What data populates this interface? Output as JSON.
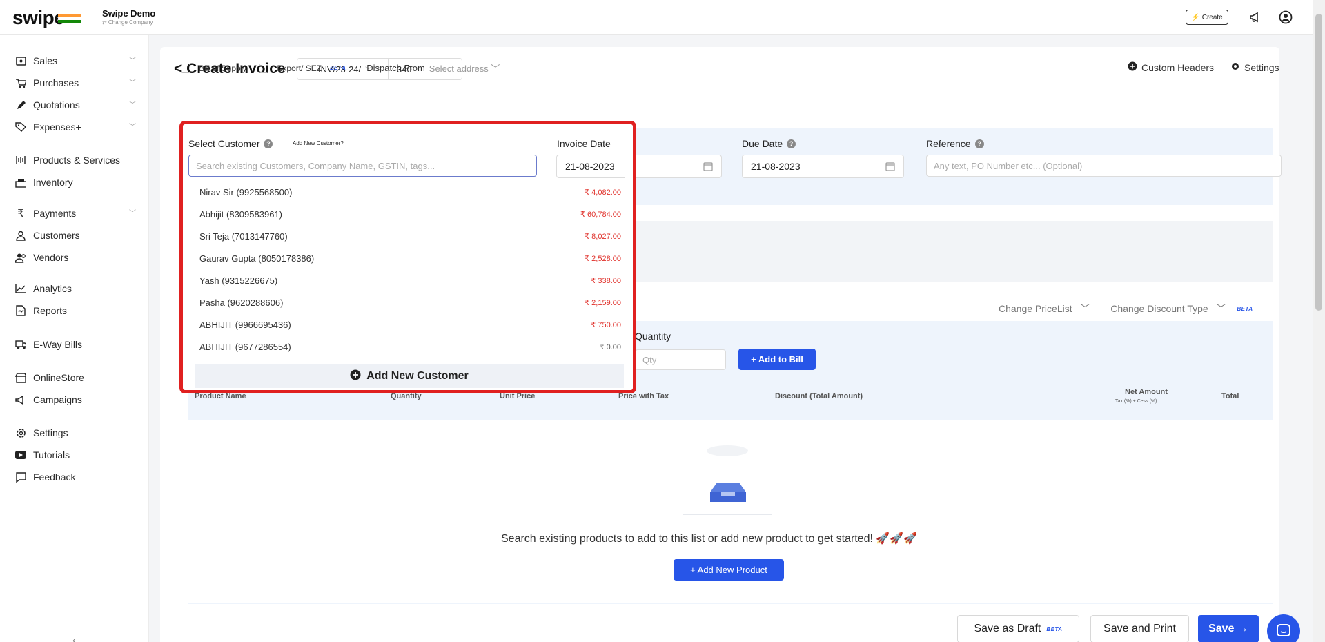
{
  "topbar": {
    "logo": "swipe",
    "company_name": "Swipe Demo",
    "change_company": "⇄ Change Company",
    "create_label": "Create"
  },
  "sidebar": {
    "items": [
      {
        "label": "Sales",
        "icon": "sales-icon",
        "has_chevron": true
      },
      {
        "label": "Purchases",
        "icon": "cart-icon",
        "has_chevron": true
      },
      {
        "label": "Quotations",
        "icon": "pen-icon",
        "has_chevron": true
      },
      {
        "label": "Expenses+",
        "icon": "tag-icon",
        "has_chevron": true
      },
      {
        "label": "Products & Services",
        "icon": "box-icon",
        "has_chevron": false
      },
      {
        "label": "Inventory",
        "icon": "inventory-icon",
        "has_chevron": false
      },
      {
        "label": "Payments",
        "icon": "rupee-icon",
        "has_chevron": true
      },
      {
        "label": "Customers",
        "icon": "user-icon",
        "has_chevron": false
      },
      {
        "label": "Vendors",
        "icon": "users-icon",
        "has_chevron": false
      },
      {
        "label": "Analytics",
        "icon": "chart-icon",
        "has_chevron": false
      },
      {
        "label": "Reports",
        "icon": "report-icon",
        "has_chevron": false
      },
      {
        "label": "E-Way Bills",
        "icon": "truck-icon",
        "has_chevron": false
      },
      {
        "label": "OnlineStore",
        "icon": "store-icon",
        "has_chevron": false
      },
      {
        "label": "Campaigns",
        "icon": "megaphone-icon",
        "has_chevron": false
      },
      {
        "label": "Settings",
        "icon": "gear-icon",
        "has_chevron": false
      },
      {
        "label": "Tutorials",
        "icon": "youtube-icon",
        "has_chevron": false
      },
      {
        "label": "Feedback",
        "icon": "chat-icon",
        "has_chevron": false
      }
    ],
    "collapse_glyph": "‹"
  },
  "header": {
    "back_label": "< Create Invoice",
    "invoice_prefix": "INV/23-24/",
    "invoice_number": "340"
  },
  "options": {
    "bill_of_supply": "Bill of Supply",
    "export_sez": "Export/ SEZ",
    "beta": "BETA",
    "dispatch_from": "Dispatch From",
    "select_address": "Select address",
    "custom_headers": "Custom Headers",
    "settings": "Settings"
  },
  "customer": {
    "label": "Select Customer",
    "add_new_link": "Add New Customer?",
    "search_placeholder": "Search existing Customers, Company Name, GSTIN, tags...",
    "list": [
      {
        "name": "Nirav Sir (9925568500)",
        "amount": "₹ 4,082.00",
        "zero": false
      },
      {
        "name": "Abhijit (8309583961)",
        "amount": "₹ 60,784.00",
        "zero": false
      },
      {
        "name": "Sri Teja (7013147760)",
        "amount": "₹ 8,027.00",
        "zero": false
      },
      {
        "name": "Gaurav Gupta (8050178386)",
        "amount": "₹ 2,528.00",
        "zero": false
      },
      {
        "name": "Yash (9315226675)",
        "amount": "₹ 338.00",
        "zero": false
      },
      {
        "name": "Pasha (9620288606)",
        "amount": "₹ 2,159.00",
        "zero": false
      },
      {
        "name": "ABHIJIT (9966695436)",
        "amount": "₹ 750.00",
        "zero": false
      },
      {
        "name": "ABHIJIT (9677286554)",
        "amount": "₹ 0.00",
        "zero": true
      }
    ],
    "add_new_button": "Add New Customer"
  },
  "dates": {
    "invoice_date_label": "Invoice Date",
    "invoice_date": "21-08-2023",
    "due_date_label": "Due Date",
    "due_date": "21-08-2023",
    "reference_label": "Reference",
    "reference_placeholder": "Any text, PO Number etc... (Optional)"
  },
  "pricing": {
    "change_pricelist": "Change PriceList",
    "change_discount": "Change Discount Type",
    "beta": "BETA"
  },
  "items": {
    "quantity_label": "Quantity",
    "qty_placeholder": "Qty",
    "add_to_bill": "+ Add to Bill",
    "columns": {
      "product_name": "Product Name",
      "quantity": "Quantity",
      "unit_price": "Unit Price",
      "price_with_tax": "Price with Tax",
      "discount": "Discount (Total Amount)",
      "net_amount": "Net Amount",
      "net_sub": "Tax (%) + Cess (%)",
      "total": "Total"
    },
    "empty_text": "Search existing products to add to this list or add new product to get started! 🚀🚀🚀",
    "add_new_product": "+ Add New Product"
  },
  "footer": {
    "save_draft": "Save as Draft",
    "beta": "BETA",
    "save_print": "Save and Print",
    "save": "Save →"
  },
  "colors": {
    "accent": "#2755e8",
    "highlight_border": "#e02020",
    "amount_red": "#e0302a"
  }
}
